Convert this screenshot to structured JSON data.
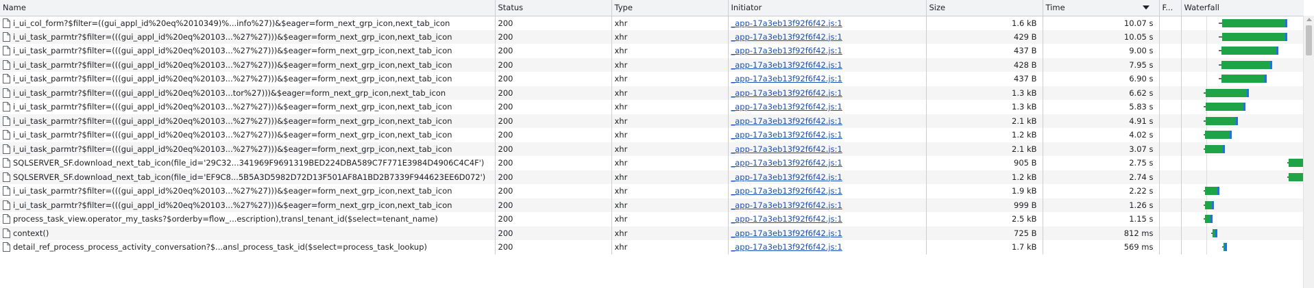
{
  "columns": {
    "name": "Name",
    "status": "Status",
    "type": "Type",
    "initiator": "Initiator",
    "size": "Size",
    "time": "Time",
    "fulfilled": "F...",
    "waterfall": "Waterfall"
  },
  "colors": {
    "ttfb": "#1ea446",
    "download": "#1a73e8",
    "link": "#1a4fb4"
  },
  "rows": [
    {
      "name": "i_ui_col_form?$filter=((gui_appl_id%20eq%2010349)%...info%27))&$eager=form_next_grp_icon,next_tab_icon",
      "status": "200",
      "type": "xhr",
      "initiator": "_app-17a3eb13f92f6f42.js:1",
      "size": "1.6 kB",
      "time": "10.07 s",
      "wf_start": 0.3,
      "wf_end": 0.86
    },
    {
      "name": "i_ui_task_parmtr?$filter=(((gui_appl_id%20eq%20103...%27%27)))&$eager=form_next_grp_icon,next_tab_icon",
      "status": "200",
      "type": "xhr",
      "initiator": "_app-17a3eb13f92f6f42.js:1",
      "size": "429 B",
      "time": "10.05 s",
      "wf_start": 0.3,
      "wf_end": 0.86
    },
    {
      "name": "i_ui_task_parmtr?$filter=(((gui_appl_id%20eq%20103...%27%27)))&$eager=form_next_grp_icon,next_tab_icon",
      "status": "200",
      "type": "xhr",
      "initiator": "_app-17a3eb13f92f6f42.js:1",
      "size": "437 B",
      "time": "9.00 s",
      "wf_start": 0.3,
      "wf_end": 0.79
    },
    {
      "name": "i_ui_task_parmtr?$filter=(((gui_appl_id%20eq%20103...%27%27)))&$eager=form_next_grp_icon,next_tab_icon",
      "status": "200",
      "type": "xhr",
      "initiator": "_app-17a3eb13f92f6f42.js:1",
      "size": "428 B",
      "time": "7.95 s",
      "wf_start": 0.3,
      "wf_end": 0.74
    },
    {
      "name": "i_ui_task_parmtr?$filter=(((gui_appl_id%20eq%20103...%27%27)))&$eager=form_next_grp_icon,next_tab_icon",
      "status": "200",
      "type": "xhr",
      "initiator": "_app-17a3eb13f92f6f42.js:1",
      "size": "437 B",
      "time": "6.90 s",
      "wf_start": 0.3,
      "wf_end": 0.69
    },
    {
      "name": "i_ui_task_parmtr?$filter=(((gui_appl_id%20eq%20103...tor%27)))&$eager=form_next_grp_icon,next_tab_icon",
      "status": "200",
      "type": "xhr",
      "initiator": "_app-17a3eb13f92f6f42.js:1",
      "size": "1.3 kB",
      "time": "6.62 s",
      "wf_start": 0.18,
      "wf_end": 0.55
    },
    {
      "name": "i_ui_task_parmtr?$filter=(((gui_appl_id%20eq%20103...%27%27)))&$eager=form_next_grp_icon,next_tab_icon",
      "status": "200",
      "type": "xhr",
      "initiator": "_app-17a3eb13f92f6f42.js:1",
      "size": "1.3 kB",
      "time": "5.83 s",
      "wf_start": 0.18,
      "wf_end": 0.52
    },
    {
      "name": "i_ui_task_parmtr?$filter=(((gui_appl_id%20eq%20103...%27%27)))&$eager=form_next_grp_icon,next_tab_icon",
      "status": "200",
      "type": "xhr",
      "initiator": "_app-17a3eb13f92f6f42.js:1",
      "size": "2.1 kB",
      "time": "4.91 s",
      "wf_start": 0.18,
      "wf_end": 0.46
    },
    {
      "name": "i_ui_task_parmtr?$filter=(((gui_appl_id%20eq%20103...%27%27)))&$eager=form_next_grp_icon,next_tab_icon",
      "status": "200",
      "type": "xhr",
      "initiator": "_app-17a3eb13f92f6f42.js:1",
      "size": "1.2 kB",
      "time": "4.02 s",
      "wf_start": 0.18,
      "wf_end": 0.41
    },
    {
      "name": "i_ui_task_parmtr?$filter=(((gui_appl_id%20eq%20103...%27%27)))&$eager=form_next_grp_icon,next_tab_icon",
      "status": "200",
      "type": "xhr",
      "initiator": "_app-17a3eb13f92f6f42.js:1",
      "size": "2.1 kB",
      "time": "3.07 s",
      "wf_start": 0.18,
      "wf_end": 0.35
    },
    {
      "name": "SQLSERVER_SF.download_next_tab_icon(file_id='29C32...341969F9691319BED224DBA589C7F771E3984D4906C4C4F')",
      "status": "200",
      "type": "xhr",
      "initiator": "_app-17a3eb13f92f6f42.js:1",
      "size": "905 B",
      "time": "2.75 s",
      "wf_start": 0.86,
      "wf_end": 1.0
    },
    {
      "name": "SQLSERVER_SF.download_next_tab_icon(file_id='EF9C8...5B5A3D5982D72D13F501AF8A1BD2B7339F944623EE6D072')",
      "status": "200",
      "type": "xhr",
      "initiator": "_app-17a3eb13f92f6f42.js:1",
      "size": "1.2 kB",
      "time": "2.74 s",
      "wf_start": 0.86,
      "wf_end": 1.0
    },
    {
      "name": "i_ui_task_parmtr?$filter=(((gui_appl_id%20eq%20103...%27%27)))&$eager=form_next_grp_icon,next_tab_icon",
      "status": "200",
      "type": "xhr",
      "initiator": "_app-17a3eb13f92f6f42.js:1",
      "size": "1.9 kB",
      "time": "2.22 s",
      "wf_start": 0.18,
      "wf_end": 0.31
    },
    {
      "name": "i_ui_task_parmtr?$filter=(((gui_appl_id%20eq%20103...%27%27)))&$eager=form_next_grp_icon,next_tab_icon",
      "status": "200",
      "type": "xhr",
      "initiator": "_app-17a3eb13f92f6f42.js:1",
      "size": "999 B",
      "time": "1.26 s",
      "wf_start": 0.18,
      "wf_end": 0.26
    },
    {
      "name": "process_task_view.operator_my_tasks?$orderby=flow_...escription),transl_tenant_id($select=tenant_name)",
      "status": "200",
      "type": "xhr",
      "initiator": "_app-17a3eb13f92f6f42.js:1",
      "size": "2.5 kB",
      "time": "1.15 s",
      "wf_start": 0.18,
      "wf_end": 0.25
    },
    {
      "name": "context()",
      "status": "200",
      "type": "xhr",
      "initiator": "_app-17a3eb13f92f6f42.js:1",
      "size": "725 B",
      "time": "812 ms",
      "wf_start": 0.24,
      "wf_end": 0.29
    },
    {
      "name": "detail_ref_process_process_activity_conversation?$...ansl_process_task_id($select=process_task_lookup)",
      "status": "200",
      "type": "xhr",
      "initiator": "_app-17a3eb13f92f6f42.js:1",
      "size": "1.7 kB",
      "time": "569 ms",
      "wf_start": 0.33,
      "wf_end": 0.37
    }
  ]
}
